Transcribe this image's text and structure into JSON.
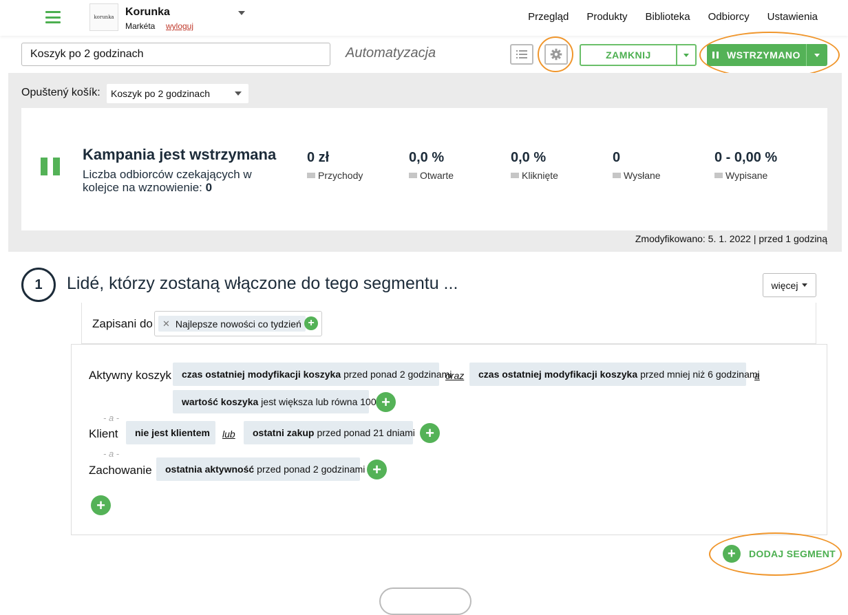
{
  "header": {
    "logo_text": "korunka",
    "account_name": "Korunka",
    "user_name": "Markéta",
    "logout_label": "wyloguj",
    "nav": [
      "Przegląd",
      "Produkty",
      "Biblioteka",
      "Odbiorcy",
      "Ustawienia"
    ]
  },
  "toolbar": {
    "automation_name": "Koszyk po 2 godzinach",
    "type_label": "Automatyzacja",
    "close_label": "ZAMKNIJ",
    "status_label": "WSTRZYMANO"
  },
  "abandoned": {
    "label": "Opuštený košík:",
    "selected": "Koszyk po 2 godzinach"
  },
  "campaign": {
    "title": "Kampania jest wstrzymana",
    "desc": "Liczba odbiorców czekających w kolejce na wznowienie:",
    "queue_count": "0",
    "stats": [
      {
        "value": "0 zł",
        "label": "Przychody"
      },
      {
        "value": "0,0 %",
        "label": "Otwarte"
      },
      {
        "value": "0,0 %",
        "label": "Kliknięte"
      },
      {
        "value": "0",
        "label": "Wysłane"
      },
      {
        "value": "0 - 0,00 %",
        "label": "Wypisane"
      }
    ],
    "modified": "Zmodyfikowano: 5. 1. 2022 | przed 1 godziną"
  },
  "segment": {
    "number": "1",
    "title": "Lidé, którzy zostaną włączone do tego segmentu ...",
    "more_label": "więcej",
    "subscribed_label": "Zapisani do",
    "subscribed_tag": "Najlepsze nowości co tydzień",
    "conditions": {
      "cart_label": "Aktywny koszyk",
      "cart_chip1_bold": "czas ostatniej modyfikacji koszyka",
      "cart_chip1_rest": "przed ponad 2 godzinami",
      "cart_conj1": "oraz",
      "cart_chip2_bold": "czas ostatniej modyfikacji koszyka",
      "cart_chip2_rest": "przed mniej niż 6 godzinami",
      "cart_conj2": "a",
      "cart_chip3_bold": "wartość koszyka",
      "cart_chip3_rest": "jest większa lub równa 100",
      "and_label": "- a -",
      "client_label": "Klient",
      "client_chip1": "nie jest klientem",
      "client_conj": "lub",
      "client_chip2_bold": "ostatni zakup",
      "client_chip2_rest": "przed ponad 21 dniami",
      "behavior_label": "Zachowanie",
      "behavior_chip_bold": "ostatnia aktywność",
      "behavior_chip_rest": "przed ponad 2 godzinami"
    },
    "add_segment_label": "DODAJ SEGMENT"
  },
  "colors": {
    "accent_green": "#54b257",
    "highlight_orange": "#f0962c",
    "dark_text": "#1c2b39"
  },
  "icons": [
    "menu-icon",
    "list-icon",
    "gear-icon",
    "pause-icon",
    "mail-icon",
    "plus-icon",
    "close-icon"
  ]
}
